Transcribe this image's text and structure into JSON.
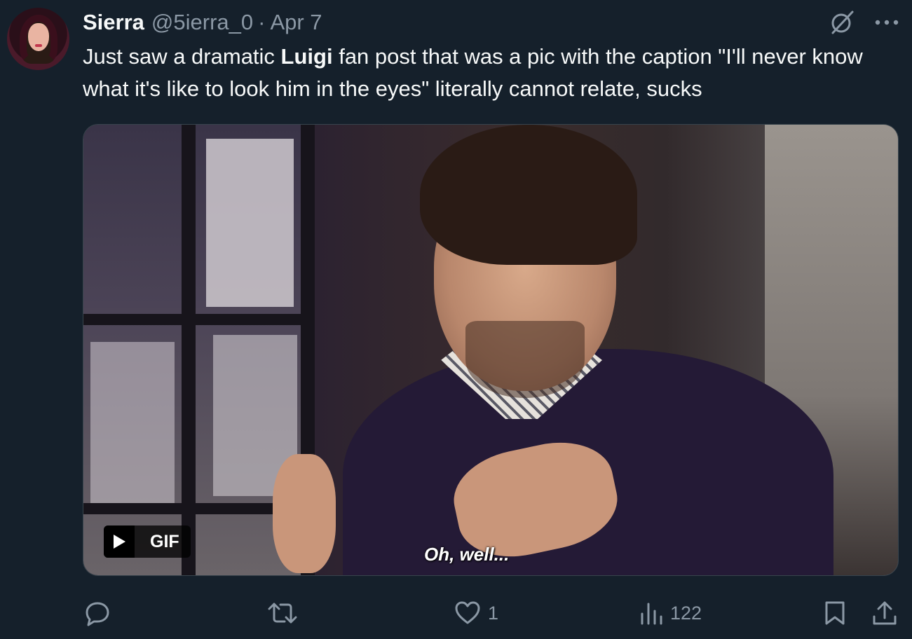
{
  "author": {
    "display_name": "Sierra",
    "handle": "@5ierra_0",
    "separator": "·",
    "date": "Apr 7"
  },
  "tweet": {
    "text_part1": "Just saw a dramatic ",
    "text_bold": "Luigi",
    "text_part2": " fan post that was a pic with the caption \"I'll never know what it's like to look him in the eyes\" literally cannot relate, sucks"
  },
  "media": {
    "badge_label": "GIF",
    "caption": "Oh, well..."
  },
  "actions": {
    "reply_count": "",
    "retweet_count": "",
    "like_count": "1",
    "views_count": "122"
  },
  "icons": {
    "grok": "grok-icon",
    "more": "more-icon",
    "reply": "reply-icon",
    "retweet": "retweet-icon",
    "like": "heart-icon",
    "views": "views-icon",
    "bookmark": "bookmark-icon",
    "share": "share-icon",
    "play": "play-icon"
  },
  "colors": {
    "background": "#15202b",
    "text_primary": "#f7f9f9",
    "text_secondary": "#8b98a5",
    "border": "#38444d"
  }
}
